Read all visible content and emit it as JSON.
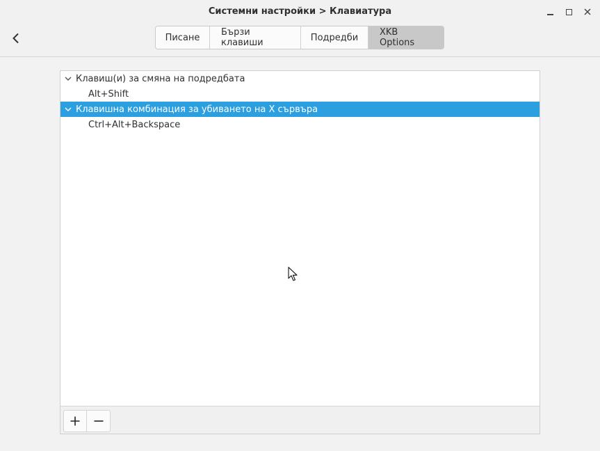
{
  "window": {
    "title": "Системни настройки > Клавиатура"
  },
  "tabs": [
    {
      "label": "Писане",
      "active": false
    },
    {
      "label": "Бързи клавиши",
      "active": false
    },
    {
      "label": "Подредби",
      "active": false
    },
    {
      "label": "XKB Options",
      "active": true
    }
  ],
  "tree": {
    "groups": [
      {
        "label": "Клавиш(и) за смяна на подредбата",
        "expanded": true,
        "selected": false,
        "children": [
          "Alt+Shift"
        ]
      },
      {
        "label": "Клавишна комбинация за убиването на X сървъра",
        "expanded": true,
        "selected": true,
        "children": [
          "Ctrl+Alt+Backspace"
        ]
      }
    ]
  },
  "toolbar": {
    "add_icon": "plus-icon",
    "remove_icon": "minus-icon"
  },
  "colors": {
    "selection": "#2b9fe0",
    "active_tab": "#c8c8c8"
  }
}
